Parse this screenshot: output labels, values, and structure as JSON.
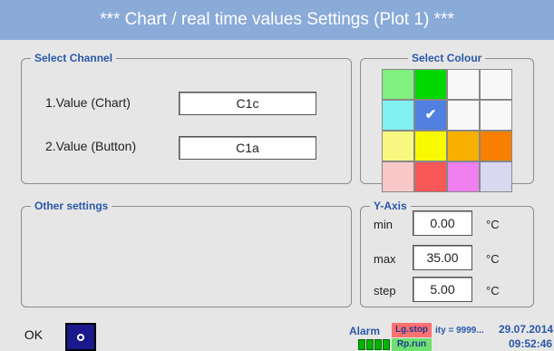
{
  "window": {
    "title": "*** Chart / real time values Settings (Plot 1) ***"
  },
  "select_channel": {
    "legend": "Select Channel",
    "rows": [
      {
        "label": "1.Value (Chart)",
        "value": "C1c"
      },
      {
        "label": "2.Value (Button)",
        "value": "C1a"
      }
    ]
  },
  "other_settings": {
    "legend": "Other settings"
  },
  "select_colour": {
    "legend": "Select Colour",
    "swatches": [
      "#80f080",
      "#00d800",
      "#f8f8f8",
      "#f8f8f8",
      "#80f0f0",
      "#5080e0",
      "#f8f8f8",
      "#f8f8f8",
      "#f8f880",
      "#f8f800",
      "#f8b000",
      "#f88000",
      "#f8c8c8",
      "#f85858",
      "#f080f0",
      "#d8d8f0"
    ],
    "selected_index": 5,
    "checkmark": "✔"
  },
  "y_axis": {
    "legend": "Y-Axis",
    "min_label": "min",
    "min_value": "0.00",
    "min_unit": "°C",
    "max_label": "max",
    "max_value": "35.00",
    "max_unit": "°C",
    "step_label": "step",
    "step_value": "5.00",
    "step_unit": "°C"
  },
  "bottom": {
    "ok_label": "OK",
    "alarm_label": "Alarm",
    "lg_stop": "Lg.stop",
    "rp_run": "Rp.run",
    "ity_text": "ity = 9999...",
    "date": "29.07.2014",
    "time": "09:52:46"
  },
  "colors": {
    "title_bar": "#8aaad8",
    "accent": "#2b58a8"
  }
}
